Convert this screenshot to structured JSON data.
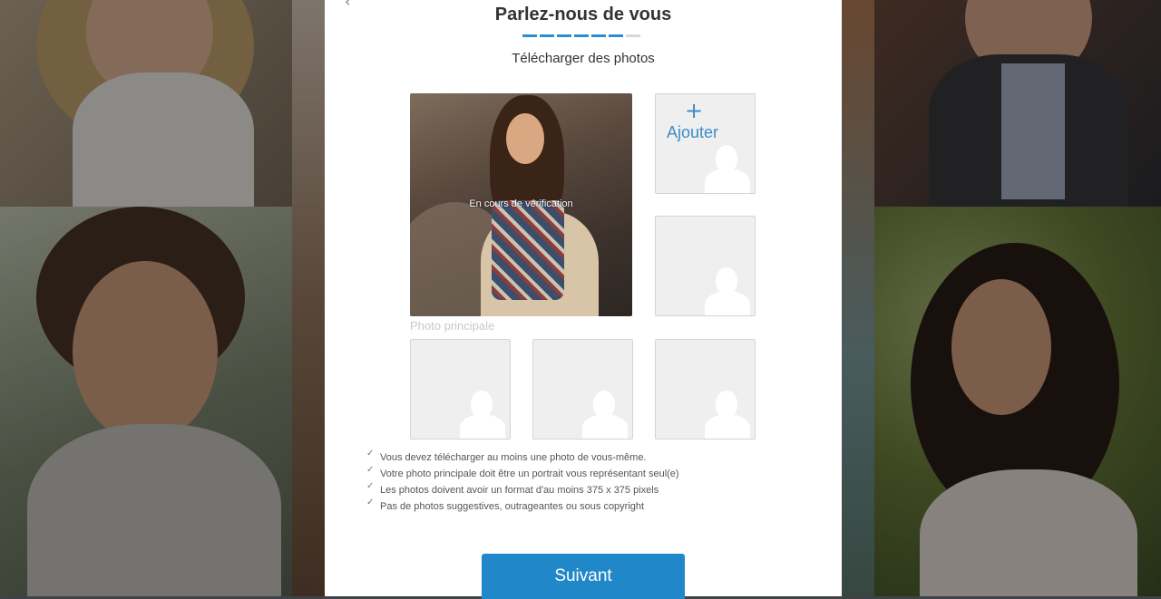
{
  "header": {
    "back_icon": "chevron-left-icon",
    "title": "Parlez-nous de vous",
    "progress": {
      "total_steps": 7,
      "completed_steps": 6
    },
    "subtitle": "Télécharger des photos"
  },
  "photos": {
    "main": {
      "status": "En cours de vérification",
      "caption": "Photo principale"
    },
    "add_slot": {
      "icon": "plus-icon",
      "label": "Ajouter"
    },
    "placeholder_icon": "person-silhouette-icon"
  },
  "rules": [
    "Vous devez télécharger au moins une photo de vous-même.",
    "Votre photo principale doit être un portrait vous représentant seul(e)",
    "Les photos doivent avoir un format d'au moins 375 x 375 pixels",
    "Pas de photos suggestives, outrageantes ou sous copyright"
  ],
  "rule_icon": "checkmark-icon",
  "actions": {
    "next_label": "Suivant"
  },
  "colors": {
    "accent": "#2088c8",
    "progress_done": "#2b8ed0",
    "progress_todo": "#d8d8d8",
    "title_text": "#333333"
  }
}
